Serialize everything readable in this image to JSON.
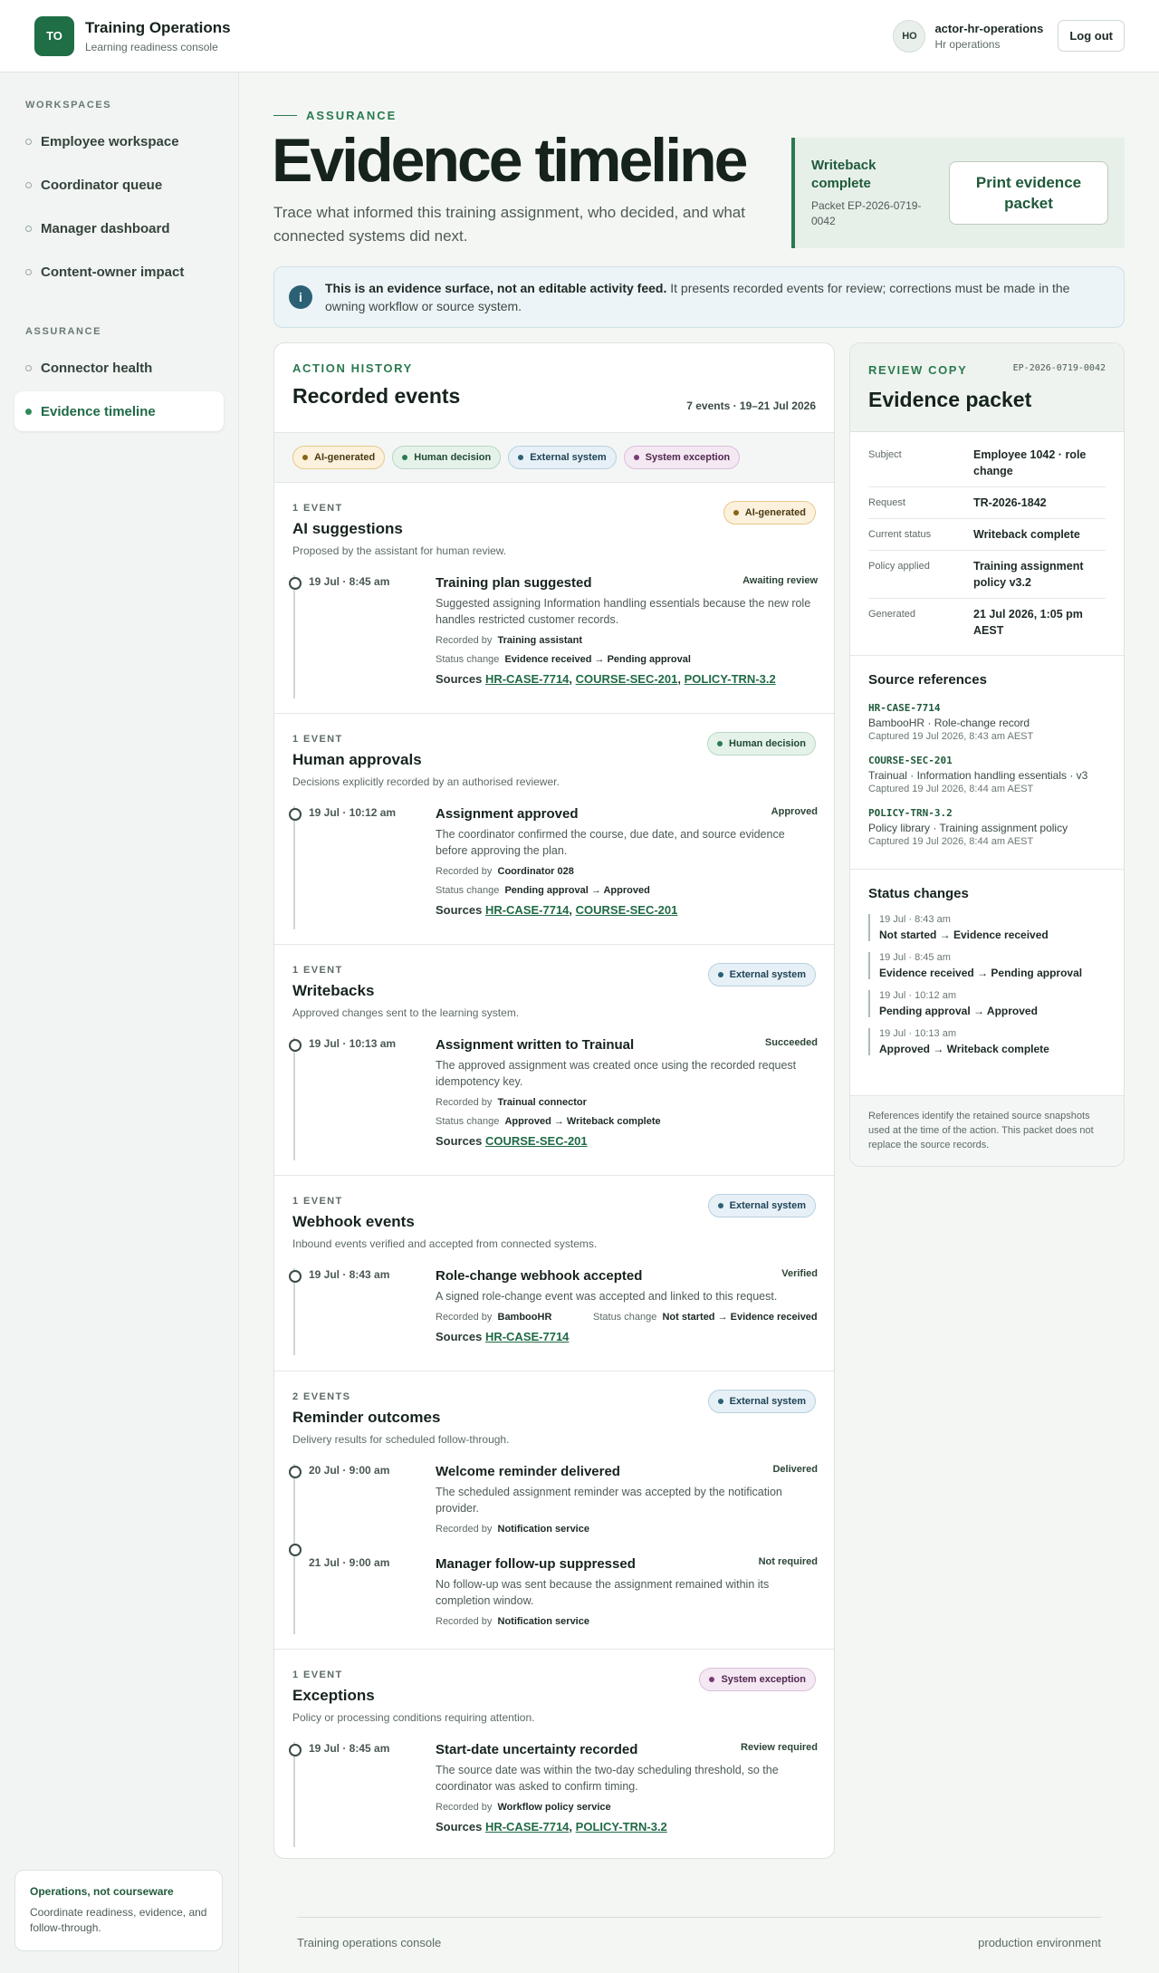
{
  "app": {
    "logo": "TO",
    "title": "Training Operations",
    "subtitle": "Learning readiness console"
  },
  "user": {
    "initials": "HO",
    "name": "actor-hr-operations",
    "role": "Hr operations",
    "logout_label": "Log out"
  },
  "sidebar": {
    "workspaces_label": "WORKSPACES",
    "workspaces": [
      "Employee workspace",
      "Coordinator queue",
      "Manager dashboard",
      "Content-owner impact"
    ],
    "assurance_label": "ASSURANCE",
    "assurance": [
      "Connector health",
      "Evidence timeline"
    ],
    "active": "Evidence timeline",
    "note_title": "Operations, not courseware",
    "note_body": "Coordinate readiness, evidence, and follow-through."
  },
  "header": {
    "eyebrow": "ASSURANCE",
    "title": "Evidence timeline",
    "lead": "Trace what informed this training assignment, who decided, and what connected systems did next.",
    "status_title": "Writeback complete",
    "status_packet": "Packet EP-2026-0719-0042",
    "print_label": "Print evidence packet"
  },
  "notice": {
    "icon": "i",
    "strong": "This is an evidence surface, not an editable activity feed.",
    "body": " It presents recorded events for review; corrections must be made in the owning workflow or source system."
  },
  "timeline": {
    "kicker": "ACTION HISTORY",
    "title": "Recorded events",
    "count": "7 events · 19–21 Jul 2026",
    "legend": [
      "AI-generated",
      "Human decision",
      "External system",
      "System exception"
    ],
    "recorded_by_label": "Recorded by",
    "status_change_label": "Status change",
    "sources_label": "Sources",
    "groups": [
      {
        "count": "1 EVENT",
        "title": "AI suggestions",
        "desc": "Proposed by the assistant for human review.",
        "chip": "AI-generated",
        "events": [
          {
            "time": "19 Jul · 8:45 am",
            "title": "Training plan suggested",
            "status": "Awaiting review",
            "desc": "Suggested assigning Information handling essentials because the new role handles restricted customer records.",
            "by": "Training assistant",
            "change": "Evidence received → Pending approval",
            "sources": [
              "HR-CASE-7714",
              "COURSE-SEC-201",
              "POLICY-TRN-3.2"
            ]
          }
        ]
      },
      {
        "count": "1 EVENT",
        "title": "Human approvals",
        "desc": "Decisions explicitly recorded by an authorised reviewer.",
        "chip": "Human decision",
        "events": [
          {
            "time": "19 Jul · 10:12 am",
            "title": "Assignment approved",
            "status": "Approved",
            "desc": "The coordinator confirmed the course, due date, and source evidence before approving the plan.",
            "by": "Coordinator 028",
            "change": "Pending approval → Approved",
            "sources": [
              "HR-CASE-7714",
              "COURSE-SEC-201"
            ]
          }
        ]
      },
      {
        "count": "1 EVENT",
        "title": "Writebacks",
        "desc": "Approved changes sent to the learning system.",
        "chip": "External system",
        "events": [
          {
            "time": "19 Jul · 10:13 am",
            "title": "Assignment written to Trainual",
            "status": "Succeeded",
            "desc": "The approved assignment was created once using the recorded request idempotency key.",
            "by": "Trainual connector",
            "change": "Approved → Writeback complete",
            "sources": [
              "COURSE-SEC-201"
            ]
          }
        ]
      },
      {
        "count": "1 EVENT",
        "title": "Webhook events",
        "desc": "Inbound events verified and accepted from connected systems.",
        "chip": "External system",
        "events": [
          {
            "time": "19 Jul · 8:43 am",
            "title": "Role-change webhook accepted",
            "status": "Verified",
            "desc": "A signed role-change event was accepted and linked to this request.",
            "by": "BambooHR",
            "change": "Not started → Evidence received",
            "sources": [
              "HR-CASE-7714"
            ]
          }
        ]
      },
      {
        "count": "2 EVENTS",
        "title": "Reminder outcomes",
        "desc": "Delivery results for scheduled follow-through.",
        "chip": "External system",
        "events": [
          {
            "time": "20 Jul · 9:00 am",
            "title": "Welcome reminder delivered",
            "status": "Delivered",
            "desc": "The scheduled assignment reminder was accepted by the notification provider.",
            "by": "Notification service"
          },
          {
            "time": "21 Jul · 9:00 am",
            "title": "Manager follow-up suppressed",
            "status": "Not required",
            "desc": "No follow-up was sent because the assignment remained within its completion window.",
            "by": "Notification service"
          }
        ]
      },
      {
        "count": "1 EVENT",
        "title": "Exceptions",
        "desc": "Policy or processing conditions requiring attention.",
        "chip": "System exception",
        "events": [
          {
            "time": "19 Jul · 8:45 am",
            "title": "Start-date uncertainty recorded",
            "status": "Review required",
            "desc": "The source date was within the two-day scheduling threshold, so the coordinator was asked to confirm timing.",
            "by": "Workflow policy service",
            "sources": [
              "HR-CASE-7714",
              "POLICY-TRN-3.2"
            ]
          }
        ]
      }
    ]
  },
  "packet": {
    "kicker": "REVIEW COPY",
    "id": "EP-2026-0719-0042",
    "title": "Evidence packet",
    "fields": [
      {
        "k": "Subject",
        "v": "Employee 1042 · role change"
      },
      {
        "k": "Request",
        "v": "TR-2026-1842"
      },
      {
        "k": "Current status",
        "v": "Writeback complete"
      },
      {
        "k": "Policy applied",
        "v": "Training assignment policy v3.2"
      },
      {
        "k": "Generated",
        "v": "21 Jul 2026, 1:05 pm AEST"
      }
    ],
    "refs_title": "Source references",
    "refs": [
      {
        "code": "HR-CASE-7714",
        "desc": "BambooHR · Role-change record",
        "when": "Captured 19 Jul 2026, 8:43 am AEST"
      },
      {
        "code": "COURSE-SEC-201",
        "desc": "Trainual · Information handling essentials · v3",
        "when": "Captured 19 Jul 2026, 8:44 am AEST"
      },
      {
        "code": "POLICY-TRN-3.2",
        "desc": "Policy library · Training assignment policy",
        "when": "Captured 19 Jul 2026, 8:44 am AEST"
      }
    ],
    "changes_title": "Status changes",
    "changes": [
      {
        "when": "19 Jul · 8:43 am",
        "v": "Not started → Evidence received"
      },
      {
        "when": "19 Jul · 8:45 am",
        "v": "Evidence received → Pending approval"
      },
      {
        "when": "19 Jul · 10:12 am",
        "v": "Pending approval → Approved"
      },
      {
        "when": "19 Jul · 10:13 am",
        "v": "Approved → Writeback complete"
      }
    ],
    "footnote": "References identify the retained source snapshots used at the time of the action. This packet does not replace the source records."
  },
  "footer": {
    "left": "Training operations console",
    "right": "production environment"
  }
}
